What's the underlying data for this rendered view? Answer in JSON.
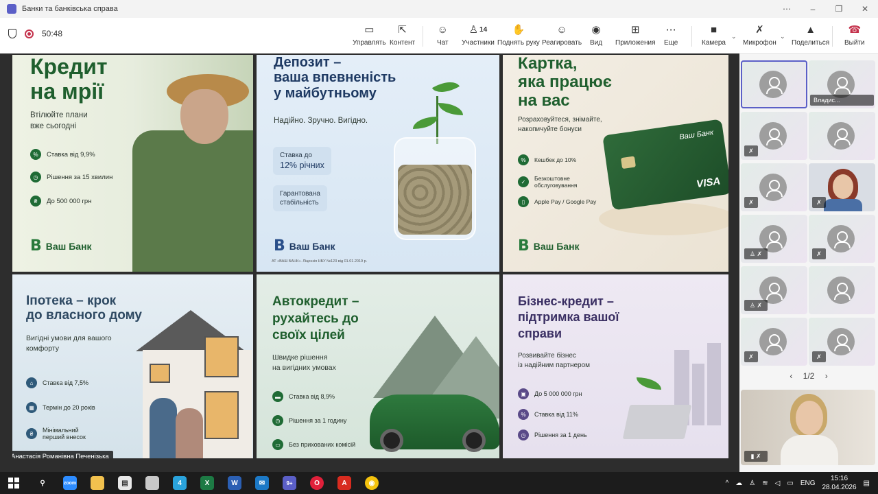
{
  "window": {
    "title": "Банки та банківська справа",
    "controls": [
      "⋯",
      "–",
      "❐",
      "✕"
    ]
  },
  "toolbar": {
    "timer": "50:48",
    "buttons": [
      {
        "id": "manage",
        "label": "Управлять",
        "icon": "▭"
      },
      {
        "id": "content",
        "label": "Контент",
        "icon": "⇱"
      },
      {
        "id": "chat",
        "label": "Чат",
        "icon": "☺"
      },
      {
        "id": "participants",
        "label": "Участники",
        "icon": "♙",
        "count": "14"
      },
      {
        "id": "hand",
        "label": "Поднять руку",
        "icon": "✋"
      },
      {
        "id": "react",
        "label": "Реагировать",
        "icon": "☺"
      },
      {
        "id": "view",
        "label": "Вид",
        "icon": "◉"
      },
      {
        "id": "apps",
        "label": "Приложения",
        "icon": "⊞"
      },
      {
        "id": "more",
        "label": "Еще",
        "icon": "⋯"
      },
      {
        "id": "camera",
        "label": "Камера",
        "icon": "■"
      },
      {
        "id": "mic",
        "label": "Микрофон",
        "icon": "✗"
      },
      {
        "id": "share",
        "label": "Поделиться",
        "icon": "▲"
      },
      {
        "id": "leave",
        "label": "Выйти",
        "icon": "☎"
      }
    ]
  },
  "slides": {
    "credit": {
      "title_1": "Кредит",
      "title_2": "на мрії",
      "sub_1": "Втілюйте плани",
      "sub_2": "вже сьогодні",
      "features": [
        "Ставка від 9,9%",
        "Рішення за 15 хвилин",
        "До 500 000 грн"
      ],
      "brand": "Ваш Банк"
    },
    "deposit": {
      "title_1": "Депозит –",
      "title_2": "ваша впевненість",
      "title_3": "у майбутньому",
      "sub": "Надійно. Зручно. Вигідно.",
      "pill_1a": "Ставка до",
      "pill_1b": "12% річних",
      "pill_2a": "Гарантована",
      "pill_2b": "стабільність",
      "brand": "Ваш Банк",
      "fineprint": "АТ «ВАШ БАНК». Ліцензія НБУ №123 від 01.01.2019 р."
    },
    "card": {
      "title_1": "Картка,",
      "title_2": "яка працює",
      "title_3": "на вас",
      "sub_1": "Розраховуйтеся, знімайте,",
      "sub_2": "накопичуйте бонуси",
      "features": [
        "Кешбек до 10%",
        "Безкоштовне обслуговування",
        "Apple Pay / Google Pay"
      ],
      "card_bank": "Ваш Банк",
      "card_network": "VISA",
      "brand": "Ваш Банк"
    },
    "mortgage": {
      "title_1": "Іпотека – крок",
      "title_2": "до власного дому",
      "sub_1": "Вигідні умови для вашого",
      "sub_2": "комфорту",
      "features": [
        "Ставка від 7,5%",
        "Термін до 20 років",
        "Мінімальний перший внесок"
      ]
    },
    "auto": {
      "title_1": "Автокредит –",
      "title_2": "рухайтесь до",
      "title_3": "своїх цілей",
      "sub_1": "Швидке рішення",
      "sub_2": "на вигідних умовах",
      "features": [
        "Ставка від 8,9%",
        "Рішення за 1 годину",
        "Без прихованих комісій"
      ]
    },
    "business": {
      "title_1": "Бізнес-кредит –",
      "title_2": "підтримка вашої",
      "title_3": "справи",
      "sub_1": "Розвивайте бізнес",
      "sub_2": "із надійним партнером",
      "features": [
        "До 5 000 000 грн",
        "Ставка від 11%",
        "Рішення за 1 день"
      ]
    }
  },
  "presenter_name": "Анастасія Романівна Печенізька",
  "participants": {
    "visible_name": "Владис...",
    "pager": "1/2"
  },
  "taskbar": {
    "lang": "ENG",
    "time": "15:16",
    "date": "28.04.2026",
    "badges": {
      "zoom": "zoom",
      "telegram": "4",
      "teams": "9+"
    }
  },
  "colors": {
    "brand_green": "#1f5f2e",
    "teams_purple": "#5b5fc7",
    "leave_red": "#c4314b"
  }
}
